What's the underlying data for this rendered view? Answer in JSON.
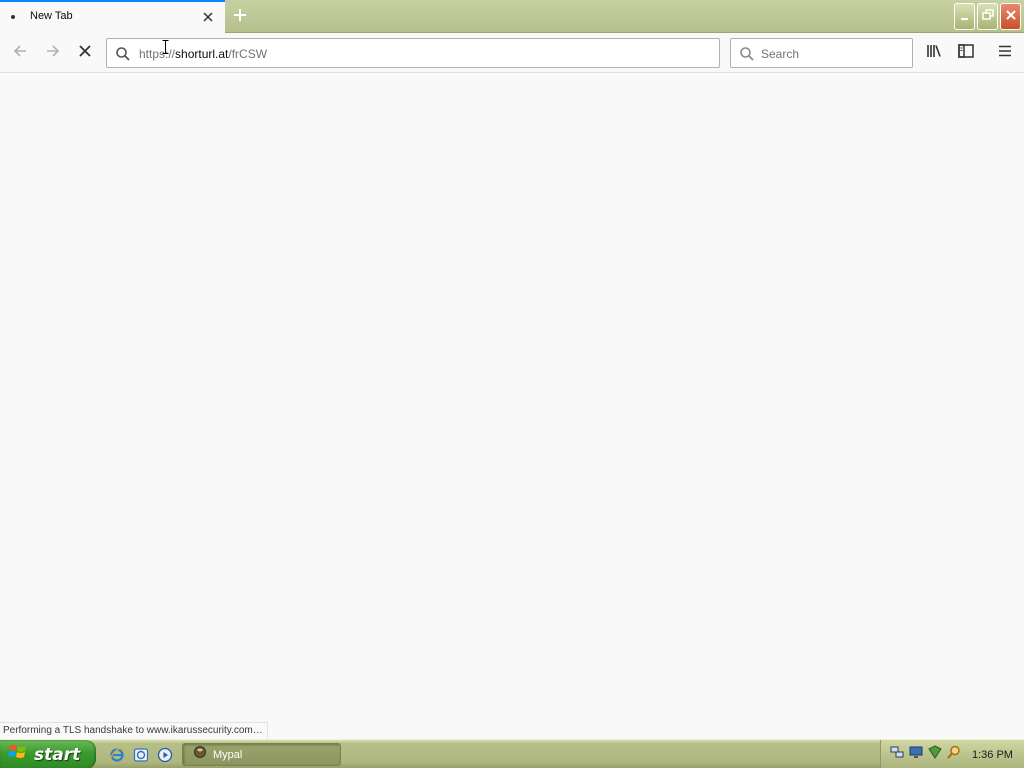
{
  "browser": {
    "tab": {
      "title": "New Tab"
    },
    "urlbar": {
      "scheme": "https://",
      "host": "shorturl.at",
      "path": "/frCSW"
    },
    "searchbar": {
      "placeholder": "Search"
    },
    "status_text": "Performing a TLS handshake to www.ikarussecurity.com…"
  },
  "taskbar": {
    "start_label": "start",
    "window_button_label": "Mypal",
    "clock": "1:36 PM"
  },
  "icons": [
    "close-icon",
    "plus-icon",
    "minimize-icon",
    "restore-icon",
    "close-window-icon",
    "back-arrow-icon",
    "forward-arrow-icon",
    "stop-icon",
    "search-icon",
    "library-icon",
    "sidebar-icon",
    "hamburger-menu-icon",
    "windows-flag-icon",
    "internet-explorer-icon",
    "browser-icon",
    "media-player-icon",
    "app-icon",
    "network-icon",
    "security-icon",
    "magnifier-icon"
  ],
  "colors": {
    "tab_accent": "#0a84ff",
    "xp_olive": "#b6bf87",
    "start_green": "#3b9b2f"
  }
}
